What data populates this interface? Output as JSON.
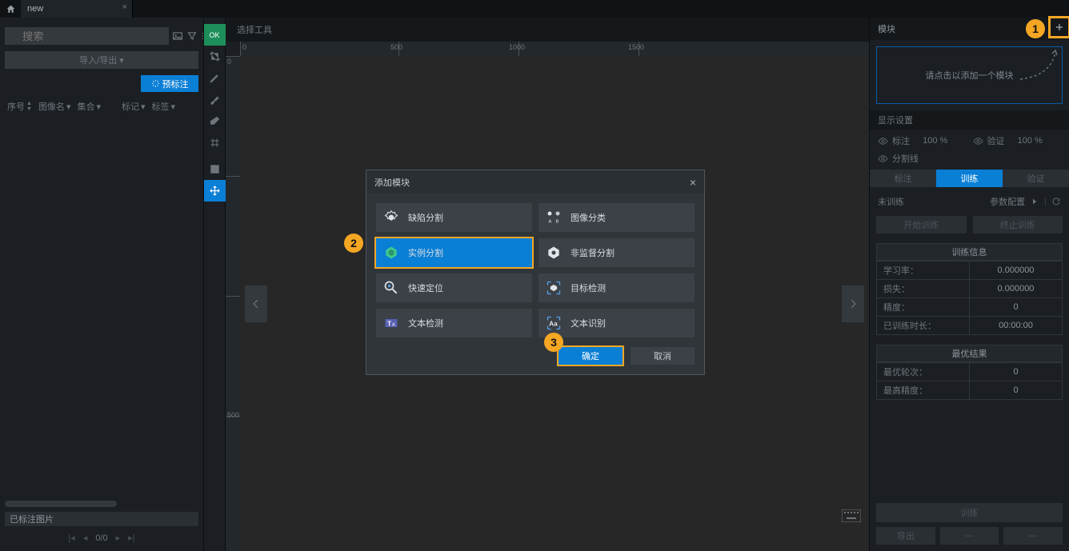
{
  "tab_name": "new",
  "left": {
    "search_placeholder": "搜索",
    "import_export": "导入/导出 ▾",
    "pre_annotate": "预标注",
    "cols": {
      "seq": "序号",
      "image": "图像名",
      "set": "集合",
      "mark": "标记",
      "tag": "标签"
    },
    "annotated": "已标注图片",
    "page": "0/0"
  },
  "vtb_ok": "OK",
  "center": {
    "title": "选择工具"
  },
  "ruler": {
    "t1": "0",
    "t2": "500",
    "t3": "1000",
    "t4": "1500"
  },
  "rulv": {
    "t1": "0",
    "t2": "500"
  },
  "right": {
    "title": "模块",
    "add_hint": "请点击以添加一个模块",
    "disp_title": "显示设置",
    "lab": "标注",
    "lab_pct": "100 %",
    "val": "验证",
    "val_pct": "100 %",
    "segline": "分割线",
    "tabs": {
      "a": "标注",
      "b": "训练",
      "c": "验证"
    },
    "train_status": "未训练",
    "param": "参数配置",
    "btn_start": "开始训练",
    "btn_stop": "终止训练",
    "info_title": "训练信息",
    "info": {
      "lr": "学习率：",
      "lr_v": "0.000000",
      "loss": "损失：",
      "loss_v": "0.000000",
      "acc": "精度：",
      "acc_v": "0",
      "time": "已训练时长：",
      "time_v": "00:00:00"
    },
    "best_title": "最优结果",
    "best": {
      "epoch": "最优轮次：",
      "epoch_v": "0",
      "acc": "最高精度：",
      "acc_v": "0"
    },
    "big_btn": "训练",
    "bb1": "导出",
    "bb2": "—",
    "bb3": "—"
  },
  "dialog": {
    "title": "添加模块",
    "opts": {
      "defect_seg": "缺陷分割",
      "img_cls": "图像分类",
      "inst_seg": "实例分割",
      "unsup_seg": "非监督分割",
      "fast_loc": "快速定位",
      "obj_det": "目标检测",
      "text_det": "文本检测",
      "text_rec": "文本识别"
    },
    "ok": "确定",
    "cancel": "取消"
  },
  "callouts": {
    "c1": "1",
    "c2": "2",
    "c3": "3"
  }
}
